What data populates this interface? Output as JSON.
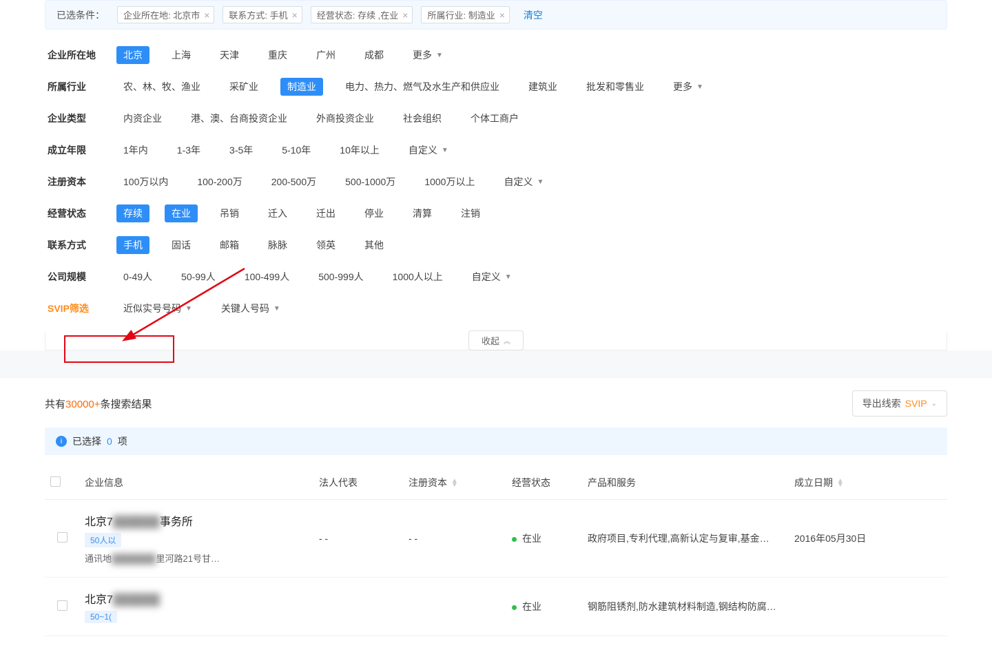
{
  "selected": {
    "label": "已选条件：",
    "tags": [
      {
        "text": "企业所在地: 北京市"
      },
      {
        "text": "联系方式: 手机"
      },
      {
        "text": "经营状态: 存续 ,在业"
      },
      {
        "text": "所属行业: 制造业"
      }
    ],
    "clear": "清空"
  },
  "filters": [
    {
      "label": "企业所在地",
      "opts": [
        {
          "t": "北京",
          "active": true
        },
        {
          "t": "上海"
        },
        {
          "t": "天津"
        },
        {
          "t": "重庆"
        },
        {
          "t": "广州"
        },
        {
          "t": "成都"
        },
        {
          "t": "更多",
          "caret": true
        }
      ]
    },
    {
      "label": "所属行业",
      "opts": [
        {
          "t": "农、林、牧、渔业"
        },
        {
          "t": "采矿业"
        },
        {
          "t": "制造业",
          "active": true
        },
        {
          "t": "电力、热力、燃气及水生产和供应业"
        },
        {
          "t": "建筑业"
        },
        {
          "t": "批发和零售业"
        },
        {
          "t": "更多",
          "caret": true
        }
      ]
    },
    {
      "label": "企业类型",
      "opts": [
        {
          "t": "内资企业"
        },
        {
          "t": "港、澳、台商投资企业"
        },
        {
          "t": "外商投资企业"
        },
        {
          "t": "社会组织"
        },
        {
          "t": "个体工商户"
        }
      ]
    },
    {
      "label": "成立年限",
      "opts": [
        {
          "t": "1年内"
        },
        {
          "t": "1-3年"
        },
        {
          "t": "3-5年"
        },
        {
          "t": "5-10年"
        },
        {
          "t": "10年以上"
        },
        {
          "t": "自定义",
          "caret": true
        }
      ]
    },
    {
      "label": "注册资本",
      "opts": [
        {
          "t": "100万以内"
        },
        {
          "t": "100-200万"
        },
        {
          "t": "200-500万"
        },
        {
          "t": "500-1000万"
        },
        {
          "t": "1000万以上"
        },
        {
          "t": "自定义",
          "caret": true
        }
      ]
    },
    {
      "label": "经营状态",
      "opts": [
        {
          "t": "存续",
          "active": true
        },
        {
          "t": "在业",
          "active": true
        },
        {
          "t": "吊销"
        },
        {
          "t": "迁入"
        },
        {
          "t": "迁出"
        },
        {
          "t": "停业"
        },
        {
          "t": "清算"
        },
        {
          "t": "注销"
        }
      ]
    },
    {
      "label": "联系方式",
      "opts": [
        {
          "t": "手机",
          "active": true
        },
        {
          "t": "固话"
        },
        {
          "t": "邮箱"
        },
        {
          "t": "脉脉"
        },
        {
          "t": "领英"
        },
        {
          "t": "其他"
        }
      ]
    },
    {
      "label": "公司规模",
      "opts": [
        {
          "t": "0-49人"
        },
        {
          "t": "50-99人"
        },
        {
          "t": "100-499人"
        },
        {
          "t": "500-999人"
        },
        {
          "t": "1000人以上"
        },
        {
          "t": "自定义",
          "caret": true
        }
      ]
    },
    {
      "label": "SVIP筛选",
      "svip": true,
      "opts": [
        {
          "t": "近似实号号码",
          "caret": true
        },
        {
          "t": "关键人号码",
          "caret": true
        }
      ]
    }
  ],
  "collapse": "收起",
  "results": {
    "prefix": "共有",
    "count": "30000+",
    "suffix": "条搜索结果",
    "export_label": "导出线索",
    "export_svip": "SVIP"
  },
  "select_info": {
    "pre": "已选择",
    "num": "0",
    "post": "项"
  },
  "columns": {
    "company": "企业信息",
    "legal": "法人代表",
    "capital": "注册资本",
    "status": "经营状态",
    "product": "产品和服务",
    "date": "成立日期"
  },
  "rows": [
    {
      "name_a": "北京7",
      "name_blur": "██████",
      "name_b": "事务所",
      "badge": "50人以",
      "addr_a": "通讯地",
      "addr_blur": "███████",
      "addr_b": "里河路21号甘…",
      "legal": "- -",
      "capital": "- -",
      "status": "在业",
      "product": "政府项目,专利代理,高新认定与复审,基金…",
      "date": "2016年05月30日"
    },
    {
      "name_a": "北京7",
      "name_blur": "██████",
      "name_b": "",
      "badge": "50~1(",
      "addr_a": "",
      "addr_blur": "",
      "addr_b": "",
      "legal": "",
      "capital": "",
      "status": "在业",
      "product": "钢筋阻锈剂,防水建筑材料制造,钢结构防腐…",
      "date": ""
    }
  ]
}
